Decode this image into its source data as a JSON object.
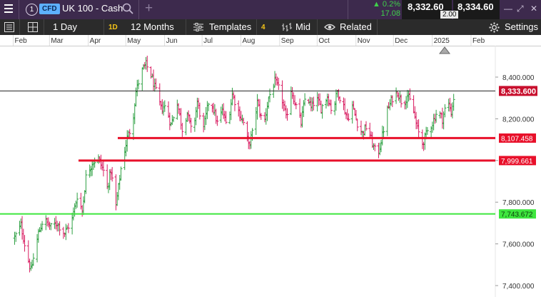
{
  "top_bar": {
    "badge": "1",
    "instrument_type": "CFD",
    "instrument_name": "UK 100 - Cash",
    "add_symbol": "+",
    "change_pct": "▲ 0.2%",
    "change_pts": "17.08",
    "sell_price": "8,332.60",
    "buy_price": "8,334.60",
    "spread": "2.00"
  },
  "toolbar": {
    "interval": "1 Day",
    "interval_badge": "1D",
    "range": "12 Months",
    "templates": "Templates",
    "templates_badge": "4",
    "price_type": "Mid",
    "related": "Related",
    "settings": "Settings"
  },
  "colors": {
    "up": "#2ea043",
    "down": "#d81b60",
    "red_line": "#e8102a",
    "green_line": "#3ee63e",
    "price_tag": "#c8102e"
  },
  "chart_data": {
    "type": "ohlc",
    "x_labels": [
      "Feb",
      "Mar",
      "Apr",
      "May",
      "Jun",
      "Jul",
      "Aug",
      "Sep",
      "Oct",
      "Nov",
      "Dec",
      "2025",
      "Feb"
    ],
    "y_ticks": [
      7400,
      7600,
      7800,
      8000,
      8200,
      8400
    ],
    "y_tick_labels": [
      "7,400.000",
      "7,600.000",
      "7,800.000",
      "8,000.000",
      "8,200.000",
      "8,400.000"
    ],
    "ylim": [
      7370,
      8570
    ],
    "current_price": {
      "value": 8333.6,
      "label": "8,333.600"
    },
    "lines": [
      {
        "value": 8107.458,
        "label": "8,107.458",
        "color": "red",
        "start_month": "May"
      },
      {
        "value": 7999.661,
        "label": "7,999.661",
        "color": "red",
        "start_month": "Apr"
      },
      {
        "value": 7743.672,
        "label": "7,743.672",
        "color": "green",
        "start_month": "Feb"
      }
    ],
    "price_path": [
      [
        "2024-02-01",
        7630
      ],
      [
        "2024-02-06",
        7690
      ],
      [
        "2024-02-10",
        7570
      ],
      [
        "2024-02-14",
        7470
      ],
      [
        "2024-02-20",
        7650
      ],
      [
        "2024-02-24",
        7720
      ],
      [
        "2024-03-01",
        7680
      ],
      [
        "2024-03-06",
        7700
      ],
      [
        "2024-03-12",
        7650
      ],
      [
        "2024-03-18",
        7720
      ],
      [
        "2024-03-22",
        7830
      ],
      [
        "2024-03-26",
        7760
      ],
      [
        "2024-03-29",
        7920
      ],
      [
        "2024-04-03",
        7990
      ],
      [
        "2024-04-08",
        8010
      ],
      [
        "2024-04-12",
        7950
      ],
      [
        "2024-04-15",
        7870
      ],
      [
        "2024-04-18",
        7950
      ],
      [
        "2024-04-22",
        7780
      ],
      [
        "2024-04-26",
        7960
      ],
      [
        "2024-05-01",
        8110
      ],
      [
        "2024-05-05",
        8170
      ],
      [
        "2024-05-08",
        8330
      ],
      [
        "2024-05-12",
        8420
      ],
      [
        "2024-05-16",
        8460
      ],
      [
        "2024-05-20",
        8410
      ],
      [
        "2024-05-24",
        8330
      ],
      [
        "2024-05-28",
        8250
      ],
      [
        "2024-06-01",
        8260
      ],
      [
        "2024-06-05",
        8170
      ],
      [
        "2024-06-10",
        8280
      ],
      [
        "2024-06-14",
        8150
      ],
      [
        "2024-06-18",
        8230
      ],
      [
        "2024-06-22",
        8120
      ],
      [
        "2024-06-26",
        8280
      ],
      [
        "2024-07-01",
        8150
      ],
      [
        "2024-07-06",
        8310
      ],
      [
        "2024-07-12",
        8180
      ],
      [
        "2024-07-16",
        8240
      ],
      [
        "2024-07-20",
        8160
      ],
      [
        "2024-07-24",
        8320
      ],
      [
        "2024-07-28",
        8250
      ],
      [
        "2024-08-02",
        8180
      ],
      [
        "2024-08-06",
        8070
      ],
      [
        "2024-08-09",
        8130
      ],
      [
        "2024-08-13",
        8280
      ],
      [
        "2024-08-18",
        8160
      ],
      [
        "2024-08-22",
        8300
      ],
      [
        "2024-08-27",
        8380
      ],
      [
        "2024-09-01",
        8320
      ],
      [
        "2024-09-05",
        8200
      ],
      [
        "2024-09-09",
        8340
      ],
      [
        "2024-09-13",
        8260
      ],
      [
        "2024-09-17",
        8180
      ],
      [
        "2024-09-21",
        8330
      ],
      [
        "2024-09-25",
        8250
      ],
      [
        "2024-09-29",
        8300
      ],
      [
        "2024-10-03",
        8250
      ],
      [
        "2024-10-08",
        8310
      ],
      [
        "2024-10-12",
        8230
      ],
      [
        "2024-10-16",
        8330
      ],
      [
        "2024-10-20",
        8280
      ],
      [
        "2024-10-24",
        8200
      ],
      [
        "2024-10-28",
        8260
      ],
      [
        "2024-11-01",
        8180
      ],
      [
        "2024-11-05",
        8130
      ],
      [
        "2024-11-09",
        8170
      ],
      [
        "2024-11-13",
        8080
      ],
      [
        "2024-11-17",
        8020
      ],
      [
        "2024-11-21",
        8120
      ],
      [
        "2024-11-25",
        8240
      ],
      [
        "2024-11-29",
        8300
      ],
      [
        "2024-12-03",
        8330
      ],
      [
        "2024-12-07",
        8270
      ],
      [
        "2024-12-11",
        8310
      ],
      [
        "2024-12-15",
        8260
      ],
      [
        "2024-12-19",
        8150
      ],
      [
        "2024-12-23",
        8080
      ],
      [
        "2024-12-27",
        8140
      ],
      [
        "2024-12-31",
        8180
      ],
      [
        "2025-01-04",
        8240
      ],
      [
        "2025-01-08",
        8200
      ],
      [
        "2025-01-12",
        8290
      ],
      [
        "2025-01-15",
        8230
      ],
      [
        "2025-01-18",
        8334
      ]
    ]
  }
}
